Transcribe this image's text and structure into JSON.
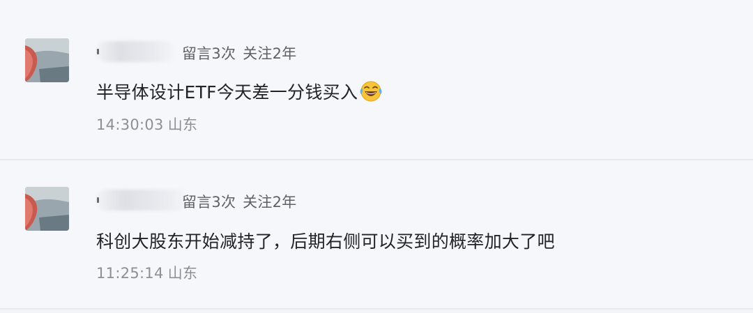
{
  "comments": [
    {
      "meta": {
        "message_count": "留言3次",
        "follow_duration": "关注2年"
      },
      "text": "半导体设计ETF今天差一分钱买入",
      "emoji": "laughing-tears-emoji",
      "time": "14:30:03",
      "location": "山东"
    },
    {
      "meta": {
        "message_count": "留言3次",
        "follow_duration": "关注2年"
      },
      "text": "科创大股东开始减持了，后期右侧可以买到的概率加大了吧",
      "time": "11:25:14",
      "location": "山东"
    }
  ],
  "colors": {
    "background": "#f6f7fa",
    "divider": "#e9eaee",
    "text": "#222326",
    "meta": "#5f6167",
    "time": "#8d8f95"
  }
}
